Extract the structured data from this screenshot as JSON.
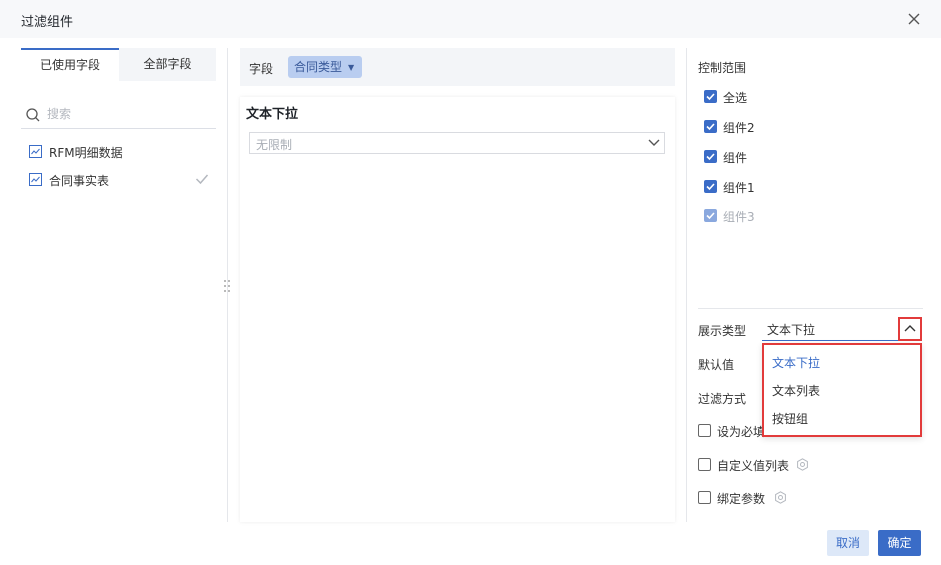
{
  "dialog": {
    "title": "过滤组件"
  },
  "left_panel": {
    "tabs": [
      {
        "label": "已使用字段",
        "active": true
      },
      {
        "label": "全部字段",
        "active": false
      }
    ],
    "search": {
      "placeholder": "搜索",
      "value": ""
    },
    "datasets": [
      {
        "label": "RFM明细数据",
        "icon": "table-icon",
        "checked": false
      },
      {
        "label": "合同事实表",
        "icon": "table-icon",
        "checked": true
      }
    ]
  },
  "center": {
    "field_label": "字段",
    "field_chip": "合同类型",
    "preview": {
      "title": "文本下拉",
      "select_placeholder": "无限制"
    }
  },
  "right_panel": {
    "control_scope": {
      "title": "控制范围",
      "items": [
        {
          "label": "全选",
          "checked": true,
          "disabled": false
        },
        {
          "label": "组件2",
          "checked": true,
          "disabled": false
        },
        {
          "label": "组件",
          "checked": true,
          "disabled": false
        },
        {
          "label": "组件1",
          "checked": true,
          "disabled": false
        },
        {
          "label": "组件3",
          "checked": true,
          "disabled": true
        }
      ]
    },
    "display_type": {
      "label": "展示类型",
      "value": "文本下拉",
      "options": [
        "文本下拉",
        "文本列表",
        "按钮组"
      ],
      "selected_index": 0
    },
    "default_value_label": "默认值",
    "filter_method_label": "过滤方式",
    "required": {
      "label": "设为必填",
      "checked": false
    },
    "custom_value_list": {
      "label": "自定义值列表",
      "checked": false
    },
    "bind_params": {
      "label": "绑定参数",
      "checked": false
    }
  },
  "footer": {
    "cancel_label": "取消",
    "ok_label": "确定"
  },
  "colors": {
    "accent": "#3a6cc7",
    "highlight_border": "#e23b3b",
    "chip_bg": "#b9cdf0"
  }
}
